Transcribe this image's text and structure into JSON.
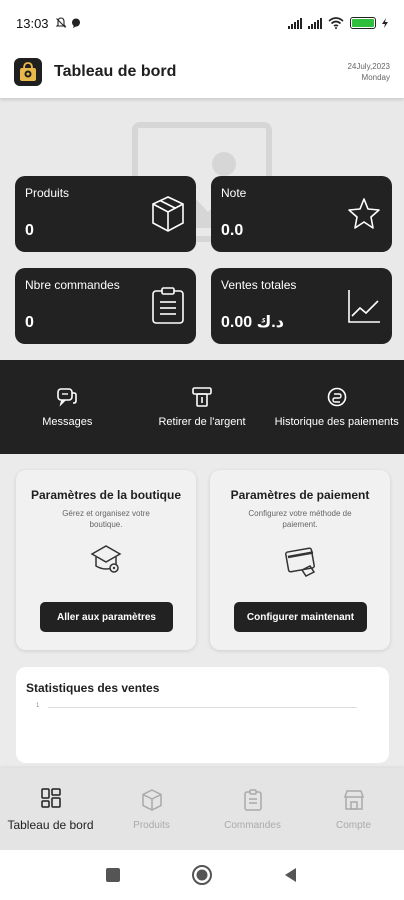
{
  "status_bar": {
    "time": "13:03"
  },
  "app_bar": {
    "title": "Tableau de bord",
    "date": "24July,2023",
    "weekday": "Monday"
  },
  "stat_cards": [
    {
      "label": "Produits",
      "value": "0",
      "icon": "box-icon"
    },
    {
      "label": "Note",
      "value": "0.0",
      "icon": "star-icon"
    },
    {
      "label": "Nbre commandes",
      "value": "0",
      "icon": "clipboard-icon"
    },
    {
      "label": "Ventes totales",
      "value": "0.00 د.ك",
      "icon": "chart-line-icon"
    }
  ],
  "actions": [
    {
      "label": "Messages",
      "icon": "chat-icon"
    },
    {
      "label": "Retirer de l'argent",
      "icon": "withdraw-icon"
    },
    {
      "label": "Historique des paiements",
      "icon": "payment-history-icon"
    }
  ],
  "settings_cards": [
    {
      "title": "Paramètres de la boutique",
      "description": "Gérez et organisez votre boutique.",
      "button": "Aller aux paramètres",
      "icon": "store-settings-icon"
    },
    {
      "title": "Paramètres de paiement",
      "description": "Configurez votre méthode de paiement.",
      "button": "Configurer maintenant",
      "icon": "credit-card-icon"
    }
  ],
  "sales_stats": {
    "title": "Statistiques des ventes",
    "tick": "1"
  },
  "bottom_nav": [
    {
      "label": "Tableau de bord",
      "icon": "dashboard-icon",
      "active": true
    },
    {
      "label": "Produits",
      "icon": "box-icon",
      "active": false
    },
    {
      "label": "Commandes",
      "icon": "clipboard-icon",
      "active": false
    },
    {
      "label": "Compte",
      "icon": "store-icon",
      "active": false
    }
  ]
}
